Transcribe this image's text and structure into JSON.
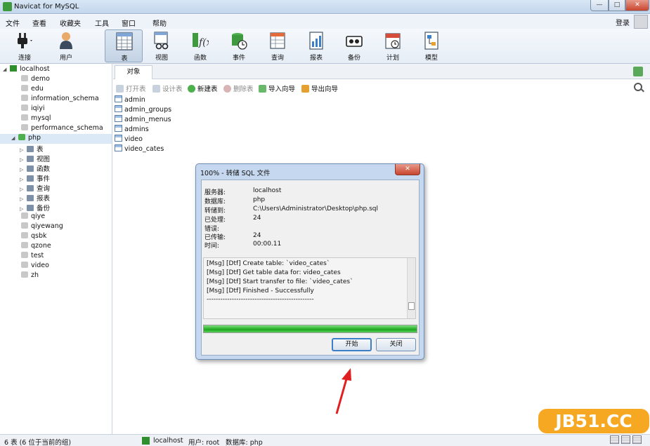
{
  "window": {
    "title": "Navicat for MySQL",
    "min": "—",
    "max": "□",
    "close": "✕"
  },
  "menu": [
    "文件",
    "查看",
    "收藏夹",
    "工具",
    "窗口",
    "帮助"
  ],
  "login": "登录",
  "toolbar": [
    {
      "label": "连接",
      "icon": "connect-icon"
    },
    {
      "label": "用户",
      "icon": "user-icon"
    },
    {
      "label": "表",
      "icon": "table-icon",
      "active": true
    },
    {
      "label": "视图",
      "icon": "view-icon"
    },
    {
      "label": "函数",
      "icon": "function-icon"
    },
    {
      "label": "事件",
      "icon": "event-icon"
    },
    {
      "label": "查询",
      "icon": "query-icon"
    },
    {
      "label": "报表",
      "icon": "report-icon"
    },
    {
      "label": "备份",
      "icon": "backup-icon"
    },
    {
      "label": "计划",
      "icon": "schedule-icon"
    },
    {
      "label": "模型",
      "icon": "model-icon"
    }
  ],
  "tree": {
    "server": "localhost",
    "databases": [
      "demo",
      "edu",
      "information_schema",
      "iqiyi",
      "mysql",
      "performance_schema",
      "php"
    ],
    "php_children": [
      "表",
      "视图",
      "函数",
      "事件",
      "查询",
      "报表",
      "备份"
    ],
    "databases_after": [
      "qiye",
      "qiyewang",
      "qsbk",
      "qzone",
      "test",
      "video",
      "zh"
    ]
  },
  "tab": {
    "label": "对象"
  },
  "subtoolbar": {
    "open": "打开表",
    "design": "设计表",
    "new": "新建表",
    "delete": "删除表",
    "import": "导入向导",
    "export": "导出向导"
  },
  "tables": [
    "admin",
    "admin_groups",
    "admin_menus",
    "admins",
    "video",
    "video_cates"
  ],
  "dialog": {
    "title": "100% - 转储 SQL 文件",
    "fields": [
      {
        "label": "服务器:",
        "value": "localhost"
      },
      {
        "label": "数据库:",
        "value": "php"
      },
      {
        "label": "转储到:",
        "value": "C:\\Users\\Administrator\\Desktop\\php.sql"
      },
      {
        "label": "已处理:",
        "value": "24"
      },
      {
        "label": "错误:",
        "value": ""
      },
      {
        "label": "已传输:",
        "value": "24"
      },
      {
        "label": "时间:",
        "value": "00:00.11"
      }
    ],
    "log": [
      "[Msg] [Dtf] Create table: `video_cates`",
      "[Msg] [Dtf] Get table data for: video_cates",
      "[Msg] [Dtf] Start transfer to file: `video_cates`",
      "[Msg] [Dtf] Finished - Successfully",
      "-----------------------------------------------"
    ],
    "progress": 1.0,
    "start_button": "开始",
    "close_button": "关闭"
  },
  "status": {
    "count": "6 表 (6 位于当前的组)",
    "server": "localhost",
    "user": "用户: root",
    "db": "数据库: php"
  },
  "watermark": "JB51.CC"
}
